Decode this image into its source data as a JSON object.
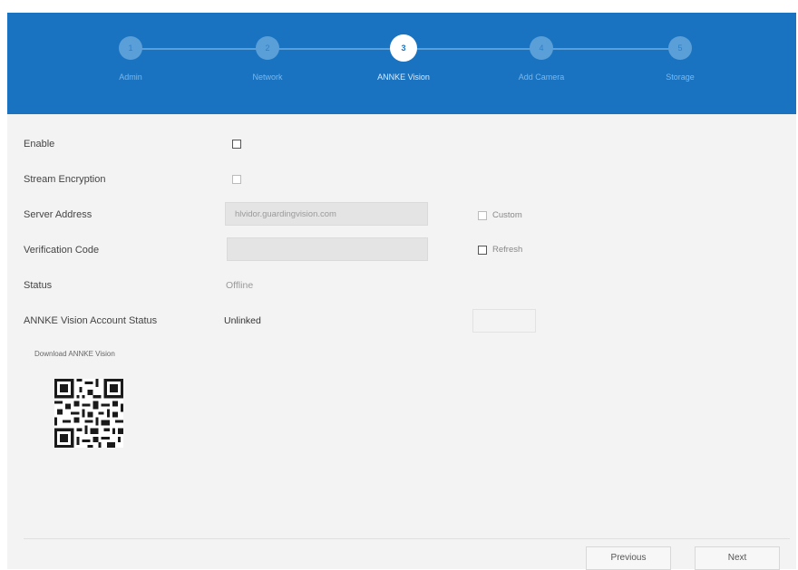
{
  "wizard": {
    "steps": [
      {
        "number": "1",
        "label": "Admin",
        "active": false
      },
      {
        "number": "2",
        "label": "Network",
        "active": false
      },
      {
        "number": "3",
        "label": "ANNKE Vision",
        "active": true
      },
      {
        "number": "4",
        "label": "Add Camera",
        "active": false
      },
      {
        "number": "5",
        "label": "Storage",
        "active": false
      }
    ]
  },
  "form": {
    "enable_label": "Enable",
    "stream_encryption_label": "Stream Encryption",
    "server_address_label": "Server Address",
    "server_address_value": "hlvidor.guardingvision.com",
    "custom_label": "Custom",
    "verification_code_label": "Verification Code",
    "verification_code_value": "",
    "refresh_label": "Refresh",
    "status_label": "Status",
    "status_value": "Offline",
    "account_status_label": "ANNKE Vision Account Status",
    "account_status_value": "Unlinked",
    "download_label": "Download ANNKE Vision"
  },
  "footer": {
    "previous_label": "Previous",
    "next_label": "Next"
  },
  "colors": {
    "header": "#1a73c0",
    "step_inactive": "#5b9fd8",
    "step_active": "#ffffff"
  }
}
